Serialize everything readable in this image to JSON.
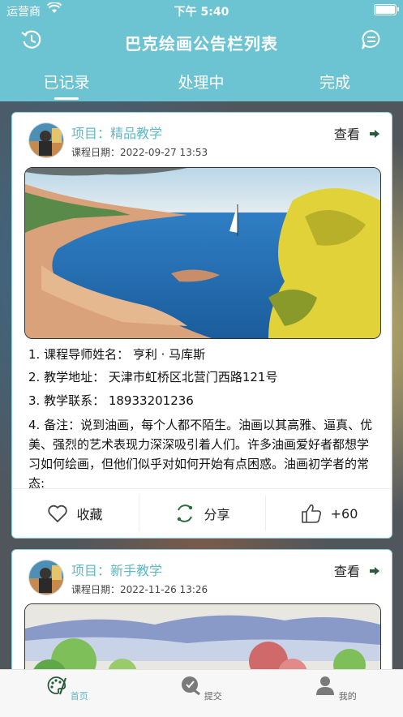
{
  "status": {
    "carrier": "运营商",
    "time": "下午 5:40"
  },
  "header": {
    "title": "巴克绘画公告栏列表",
    "left_icon": "history-icon",
    "right_icon": "message-icon"
  },
  "tabs": [
    {
      "label": "已记录"
    },
    {
      "label": "处理中"
    },
    {
      "label": "完成"
    }
  ],
  "colors": {
    "accent": "#6cc3d1",
    "project_text": "#5fb8c6"
  },
  "cards": [
    {
      "project": "项目：精品教学",
      "date": "课程日期：2022-09-27 13:53",
      "view_label": "查看",
      "details": {
        "teacher": "1. 课程导师姓名： 亨利 · 马库斯",
        "address": "2. 教学地址： 天津市虹桥区北营门西路121号",
        "contact": "3. 教学联系： 18933201236",
        "note": "4. 备注：说到油画，每个人都不陌生。油画以其高雅、逼真、优美、强烈的艺术表现力深深吸引着人们。许多油画爱好者都想学习如何绘画，但他们似乎对如何开始有点困惑。油画初学者的常态:"
      },
      "actions": {
        "favorite": "收藏",
        "share": "分享",
        "likes": "+60"
      }
    },
    {
      "project": "项目：新手教学",
      "date": "课程日期：2022-11-26 13:26",
      "view_label": "查看"
    }
  ],
  "tabbar": [
    {
      "label": "首页",
      "icon": "palette-icon"
    },
    {
      "label": "提交",
      "icon": "submit-icon"
    },
    {
      "label": "我的",
      "icon": "profile-icon"
    }
  ]
}
